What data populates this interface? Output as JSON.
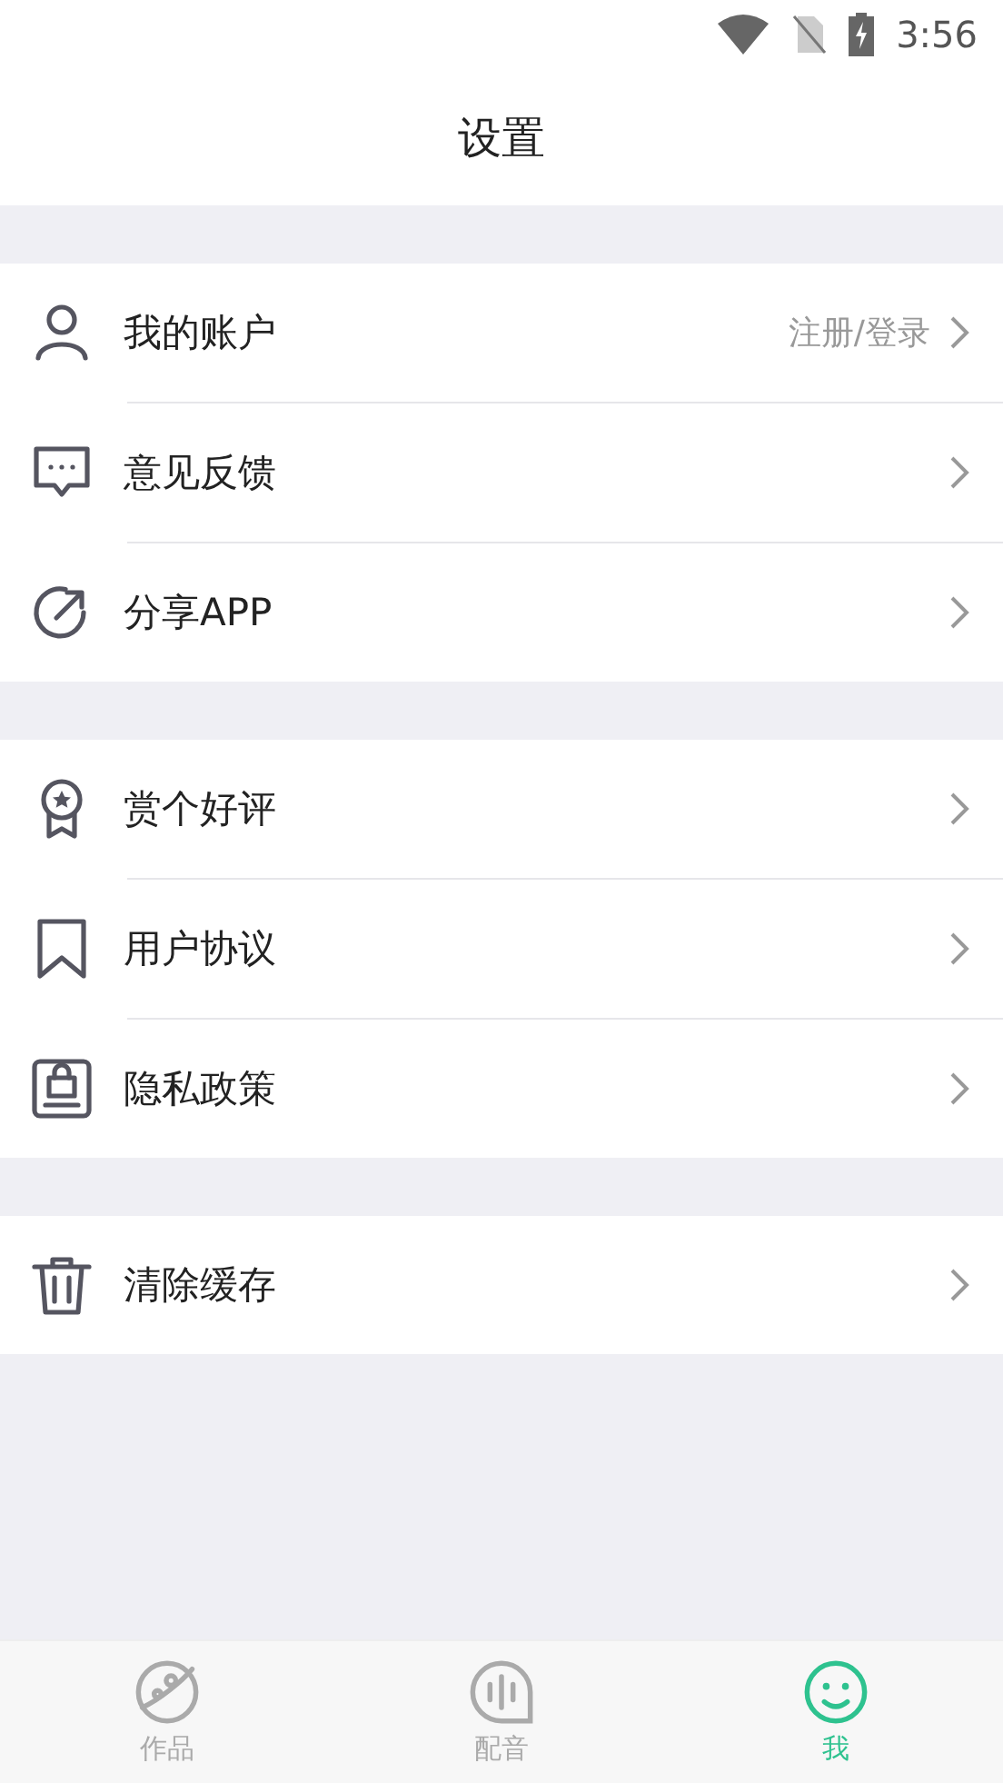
{
  "status_bar": {
    "time": "3:56"
  },
  "title": "设置",
  "groups": [
    {
      "rows": [
        {
          "label": "我的账户",
          "value": "注册/登录"
        },
        {
          "label": "意见反馈"
        },
        {
          "label": "分享APP"
        }
      ]
    },
    {
      "rows": [
        {
          "label": "赏个好评"
        },
        {
          "label": "用户协议"
        },
        {
          "label": "隐私政策"
        }
      ]
    },
    {
      "rows": [
        {
          "label": "清除缓存"
        }
      ]
    }
  ],
  "tabs": [
    {
      "label": "作品",
      "selected": false
    },
    {
      "label": "配音",
      "selected": false
    },
    {
      "label": "我",
      "selected": true
    }
  ]
}
